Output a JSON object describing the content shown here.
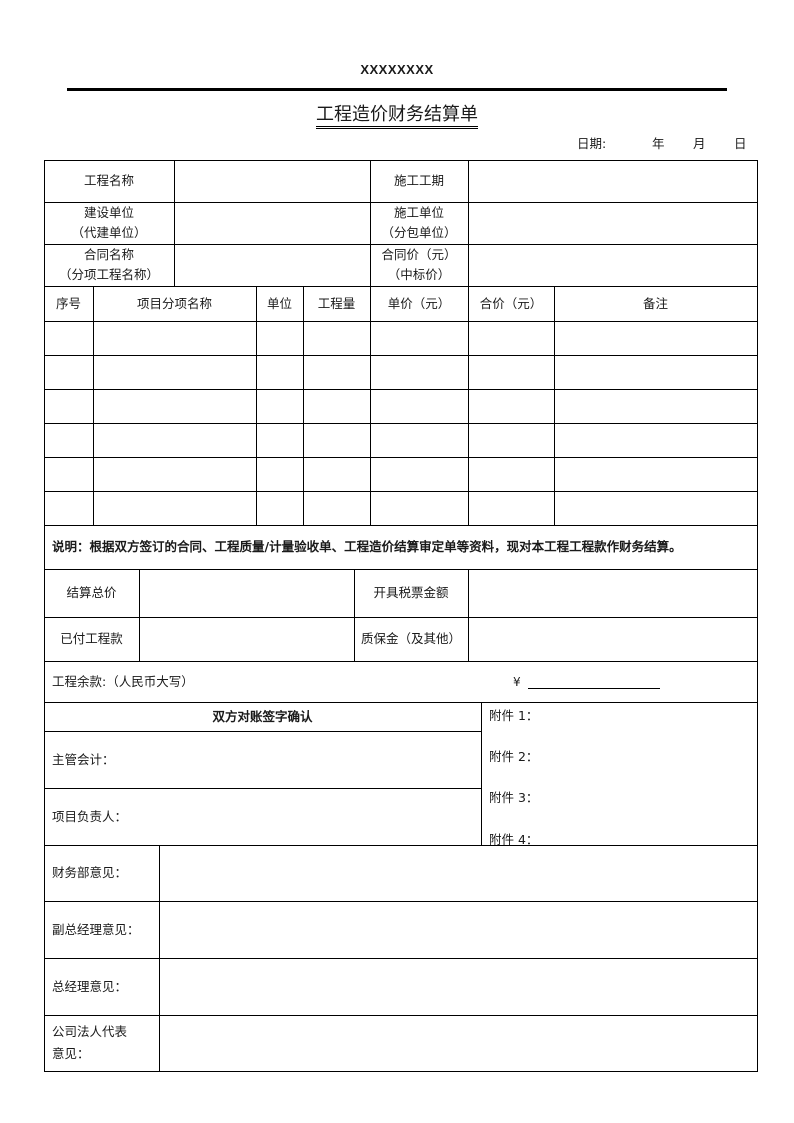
{
  "header": {
    "company": "XXXXXXXX",
    "title": "工程造价财务结算单",
    "date_label": "日期:",
    "year": "年",
    "month": "月",
    "day": "日"
  },
  "info": {
    "project_name": "工程名称",
    "construction_period": "施工工期",
    "builder_line1": "建设单位",
    "builder_line2": "（代建单位）",
    "contractor_line1": "施工单位",
    "contractor_line2": "（分包单位）",
    "contract_name_line1": "合同名称",
    "contract_name_line2": "（分项工程名称）",
    "contract_price_line1": "合同价（元）",
    "contract_price_line2": "（中标价）"
  },
  "items_table": {
    "headers": [
      "序号",
      "项目分项名称",
      "单位",
      "工程量",
      "单价（元）",
      "合价（元）",
      "备注"
    ],
    "rows": [
      [
        "",
        "",
        "",
        "",
        "",
        "",
        ""
      ],
      [
        "",
        "",
        "",
        "",
        "",
        "",
        ""
      ],
      [
        "",
        "",
        "",
        "",
        "",
        "",
        ""
      ],
      [
        "",
        "",
        "",
        "",
        "",
        "",
        ""
      ],
      [
        "",
        "",
        "",
        "",
        "",
        "",
        ""
      ],
      [
        "",
        "",
        "",
        "",
        "",
        "",
        ""
      ]
    ]
  },
  "note": "说明：根据双方签订的合同、工程质量/计量验收单、工程造价结算审定单等资料，现对本工程工程款作财务结算。",
  "settlement": {
    "total_label": "结算总价",
    "invoice_label": "开具税票金额",
    "paid_label": "已付工程款",
    "retention_label": "质保金（及其他）",
    "balance_label": "工程余款:（人民币大写）",
    "yen_symbol": "¥"
  },
  "signoff": {
    "title": "双方对账签字确认",
    "accountant": "主管会计：",
    "project_lead": "项目负责人：",
    "attachments": [
      "附件 1：",
      "附件 2：",
      "附件 3：",
      "附件 4："
    ]
  },
  "opinions": {
    "finance": "财务部意见：",
    "deputy_gm": "副总经理意见：",
    "gm": "总经理意见：",
    "legal_rep_line1": "公司法人代表",
    "legal_rep_line2": "意见："
  }
}
